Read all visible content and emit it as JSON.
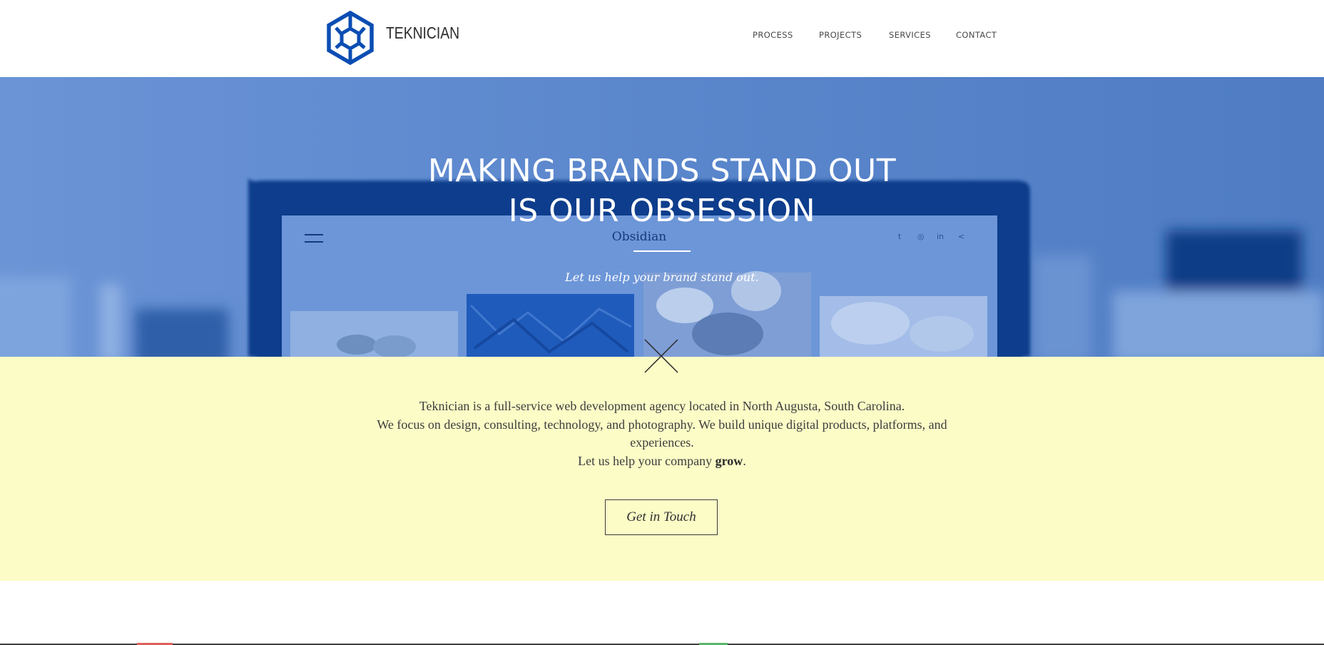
{
  "brand": {
    "name": "TEKNICIAN",
    "logo_icon": "hexagon-logo-icon",
    "color": "#0b4db3"
  },
  "nav": {
    "items": [
      "PROCESS",
      "PROJECTS",
      "SERVICES",
      "CONTACT"
    ]
  },
  "hero": {
    "title_line1": "MAKING BRANDS STAND OUT",
    "title_line2": "IS OUR OBSESSION",
    "mockup": {
      "site_name": "Obsidian",
      "tagline": "Let us help your brand stand out.",
      "social_icons": [
        "twitter-icon",
        "instagram-icon",
        "linkedin-icon",
        "share-icon"
      ],
      "social_glyphs": [
        "t",
        "◎",
        "in",
        "<"
      ]
    },
    "overlay_color": "#4f7fc9"
  },
  "intro": {
    "line1": "Teknician is a full-service web development agency located in North Augusta, South Carolina.",
    "line2": "We focus on design, consulting, technology, and photography. We build unique digital products, platforms, and experiences.",
    "line3_prefix": "Let us help your company",
    "line3_bold": "grow",
    "line3_suffix": ".",
    "cta_label": "Get in Touch",
    "background": "#fcfcc7"
  }
}
